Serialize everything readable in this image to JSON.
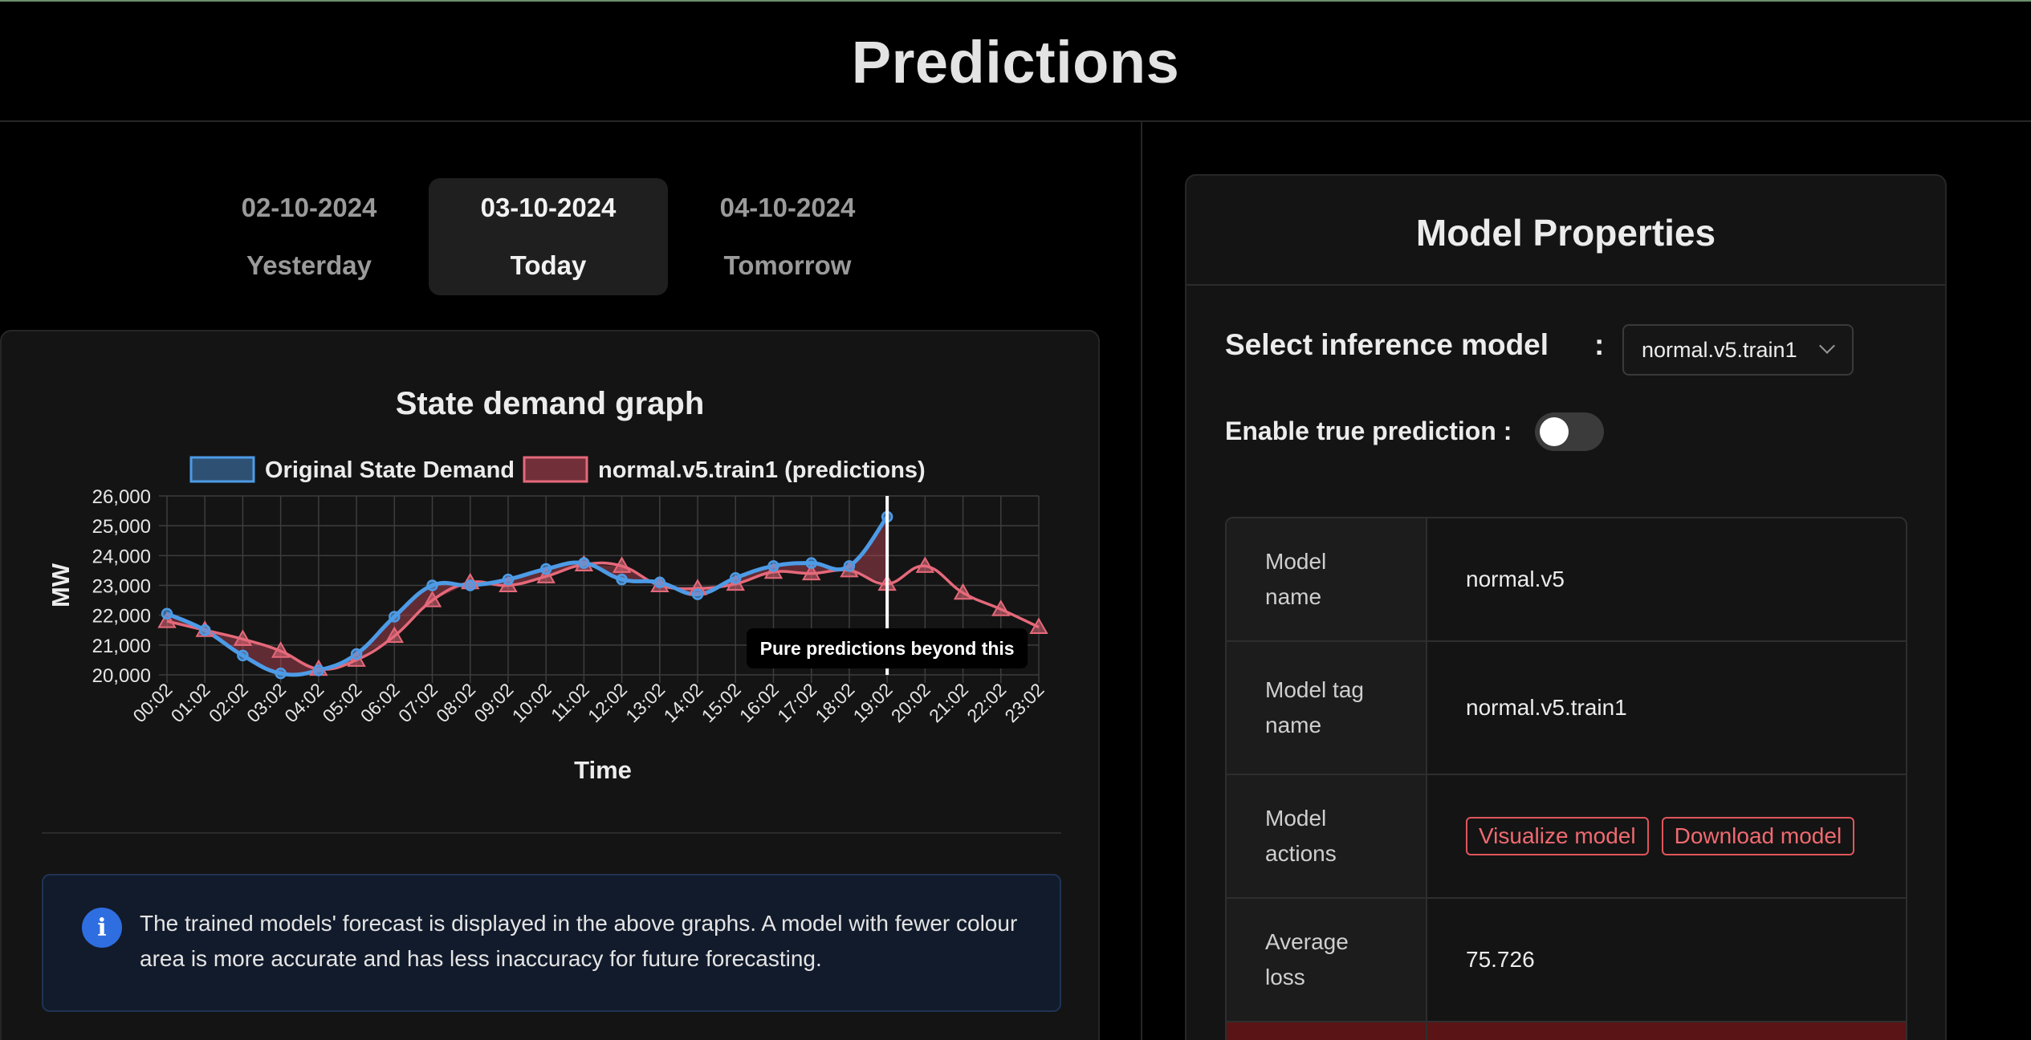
{
  "page_title": "Predictions",
  "date_tabs": [
    {
      "date": "02-10-2024",
      "label": "Yesterday"
    },
    {
      "date": "03-10-2024",
      "label": "Today",
      "active": true
    },
    {
      "date": "04-10-2024",
      "label": "Tomorrow"
    }
  ],
  "chart": {
    "title": "State demand graph",
    "annotation": "Pure predictions beyond this"
  },
  "chart_data": {
    "type": "line",
    "title": "State demand graph",
    "xlabel": "Time",
    "ylabel": "MW",
    "ylim": [
      20000,
      26000
    ],
    "yticks": [
      "20,000",
      "21,000",
      "22,000",
      "23,000",
      "24,000",
      "25,000",
      "26,000"
    ],
    "categories": [
      "00:02",
      "01:02",
      "02:02",
      "03:02",
      "04:02",
      "05:02",
      "06:02",
      "07:02",
      "08:02",
      "09:02",
      "10:02",
      "11:02",
      "12:02",
      "13:02",
      "14:02",
      "15:02",
      "16:02",
      "17:02",
      "18:02",
      "19:02",
      "20:02",
      "21:02",
      "22:02",
      "23:02"
    ],
    "grid": true,
    "legend_position": "top",
    "series": [
      {
        "name": "Original State Demand",
        "color": "#4d9be6",
        "values": [
          22050,
          21500,
          20650,
          20050,
          20150,
          20700,
          21950,
          23000,
          23000,
          23200,
          23550,
          23750,
          23200,
          23100,
          22700,
          23250,
          23650,
          23750,
          23650,
          25300
        ]
      },
      {
        "name": "normal.v5.train1 (predictions)",
        "color": "#e5697a",
        "values": [
          21800,
          21500,
          21200,
          20800,
          20200,
          20500,
          21300,
          22500,
          23100,
          23000,
          23300,
          23700,
          23650,
          23000,
          22900,
          23050,
          23450,
          23400,
          23500,
          23050,
          23650,
          22750,
          22200,
          21600
        ]
      }
    ]
  },
  "info": {
    "text": "The trained models' forecast is displayed in the above graphs. A model with fewer colour area is more accurate and has less inaccuracy for future forecasting."
  },
  "props": {
    "title": "Model Properties",
    "select_label": "Select inference model",
    "select_colon": ":",
    "selected_model": "normal.v5.train1",
    "toggle_label": "Enable true prediction :",
    "rows": [
      {
        "key": "Model name",
        "value": "normal.v5"
      },
      {
        "key": "Model tag name",
        "value": "normal.v5.train1"
      },
      {
        "key": "Model actions",
        "actions": [
          "Visualize model",
          "Download model"
        ]
      },
      {
        "key": "Average loss",
        "value": "75.726"
      }
    ]
  }
}
